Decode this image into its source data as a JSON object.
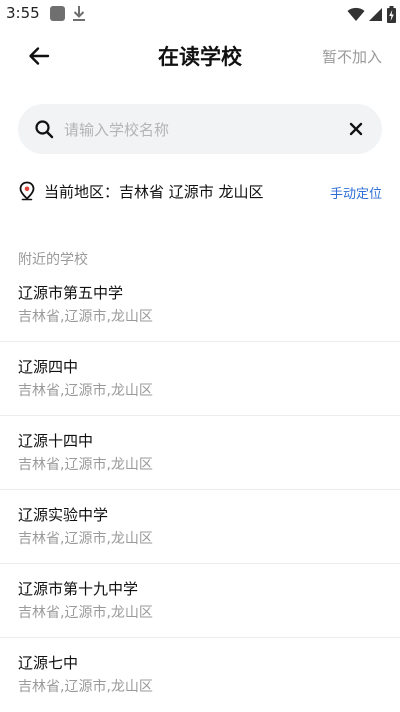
{
  "status_bar": {
    "time": "3:55",
    "icons": [
      "app-notification-icon",
      "download-icon",
      "wifi-icon",
      "cellular-signal-icon",
      "battery-charging-icon"
    ]
  },
  "header": {
    "title": "在读学校",
    "skip_label": "暂不加入",
    "back_icon": "arrow-left-icon"
  },
  "search": {
    "placeholder": "请输入学校名称",
    "value": "",
    "icon": "search-icon",
    "clear_icon": "close-icon"
  },
  "location": {
    "icon": "location-pin-icon",
    "text": "当前地区：吉林省 辽源市 龙山区",
    "action_label": "手动定位"
  },
  "nearby": {
    "section_title": "附近的学校",
    "schools": [
      {
        "name": "辽源市第五中学",
        "region": "吉林省,辽源市,龙山区"
      },
      {
        "name": "辽源四中",
        "region": "吉林省,辽源市,龙山区"
      },
      {
        "name": "辽源十四中",
        "region": "吉林省,辽源市,龙山区"
      },
      {
        "name": "辽源实验中学",
        "region": "吉林省,辽源市,龙山区"
      },
      {
        "name": "辽源市第十九中学",
        "region": "吉林省,辽源市,龙山区"
      },
      {
        "name": "辽源七中",
        "region": "吉林省,辽源市,龙山区"
      }
    ]
  },
  "colors": {
    "accent": "#2f6fd6",
    "muted_text": "#9a9a9a",
    "search_background": "#f2f3f5",
    "divider": "#ececec"
  }
}
